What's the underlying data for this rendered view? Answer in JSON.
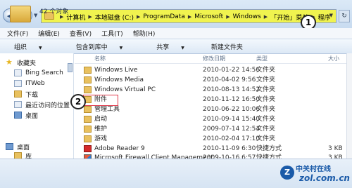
{
  "address": {
    "crumbs": [
      "计算机",
      "本地磁盘 (C:)",
      "ProgramData",
      "Microsoft",
      "Windows",
      "「开始」菜单",
      "程序"
    ],
    "callout1": "1"
  },
  "menu": [
    "文件(F)",
    "编辑(E)",
    "查看(V)",
    "工具(T)",
    "帮助(H)"
  ],
  "toolbar": {
    "organize": "组织",
    "include": "包含到库中",
    "share": "共享",
    "newfolder": "新建文件夹"
  },
  "sidebar": {
    "favorites": "收藏夹",
    "items": [
      "Bing Search",
      "ITWeb",
      "下载",
      "最近访问的位置",
      "桌面"
    ],
    "desktop": "桌面",
    "library": "库"
  },
  "columns": {
    "name": "名称",
    "date": "修改日期",
    "type": "类型",
    "size": "大小"
  },
  "files": [
    {
      "name": "Windows Live",
      "date": "2010-01-22 14:56",
      "type": "文件夹",
      "size": "",
      "icon": "folder"
    },
    {
      "name": "Windows Media",
      "date": "2010-04-02 9:56",
      "type": "文件夹",
      "size": "",
      "icon": "folder"
    },
    {
      "name": "Windows Virtual PC",
      "date": "2010-08-13 14:52",
      "type": "文件夹",
      "size": "",
      "icon": "folder"
    },
    {
      "name": "附件",
      "date": "2010-11-12 16:50",
      "type": "文件夹",
      "size": "",
      "icon": "folder"
    },
    {
      "name": "管理工具",
      "date": "2010-06-22 10:06",
      "type": "文件夹",
      "size": "",
      "icon": "folder"
    },
    {
      "name": "启动",
      "date": "2010-09-14 15:40",
      "type": "文件夹",
      "size": "",
      "icon": "folder"
    },
    {
      "name": "维护",
      "date": "2009-07-14 12:54",
      "type": "文件夹",
      "size": "",
      "icon": "folder"
    },
    {
      "name": "游戏",
      "date": "2010-02-04 17:10",
      "type": "文件夹",
      "size": "",
      "icon": "folder"
    },
    {
      "name": "Adobe Reader 9",
      "date": "2010-11-09 6:30",
      "type": "快捷方式",
      "size": "3 KB",
      "icon": "pdf"
    },
    {
      "name": "Microsoft Firewall Client Management",
      "date": "2009-10-16 6:57",
      "type": "快捷方式",
      "size": "3 KB",
      "icon": "app"
    }
  ],
  "callout2": "2",
  "status": {
    "count": "42 个对象"
  },
  "watermark": {
    "top": "中关村在线",
    "bottom": "zol.com.cn",
    "badge": "Z"
  }
}
